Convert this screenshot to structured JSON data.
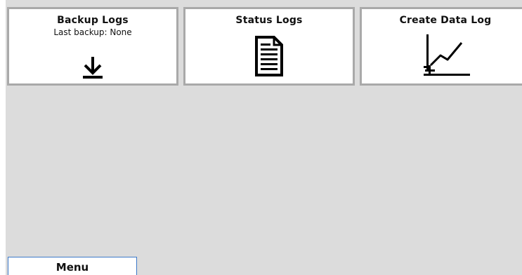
{
  "tiles": {
    "backup": {
      "title": "Backup Logs",
      "subtitle": "Last backup: None",
      "icon": "download-icon"
    },
    "status": {
      "title": "Status Logs",
      "icon": "document-icon"
    },
    "create": {
      "title": "Create Data Log",
      "icon": "create-chart-icon"
    }
  },
  "menu": {
    "label": "Menu"
  },
  "colors": {
    "background": "#dcdcdc",
    "tile_border": "#a9a9a9",
    "menu_border": "#3c78c8"
  }
}
